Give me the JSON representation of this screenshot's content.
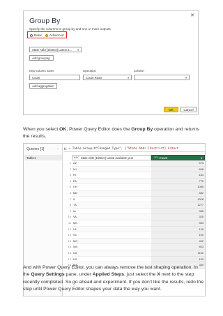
{
  "dialog": {
    "title": "Group By",
    "subtitle": "Specify the columns to group by and one or more outputs.",
    "close_glyph": "✕",
    "radio_basic": "Basic",
    "radio_advanced": "Advanced",
    "selected_mode": "Advanced",
    "group_by_value": "State Abbr [District] Latest a...",
    "add_grouping_label": "Add grouping",
    "new_column_label": "New column name",
    "new_column_value": "Count",
    "operation_label": "Operation",
    "operation_value": "Count Rows",
    "column_label": "Column",
    "add_aggregation_label": "Add aggregation",
    "ok_label": "OK",
    "cancel_label": "Cancel"
  },
  "para1": {
    "t1": "When you select ",
    "b1": "OK",
    "t2": ", Power Query Editor does the ",
    "b2": "Group By",
    "t3": " operation and returns the results."
  },
  "editor": {
    "queries_title": "Queries [1]",
    "collapse_glyph": "‹",
    "query_name": "Table1",
    "fx_label": "fx",
    "formula_prefix": "= Table.Group(#\"Changed Type\", {",
    "formula_string": "\"State Abbr [District] Latest",
    "column1_header": "State Abbr [District] Latest available year",
    "column2_header": "Count",
    "column1_type_icon": "ABC",
    "column2_type_icon": "1²3",
    "accent_color": "#217346",
    "rows": [
      {
        "n": "1",
        "state": "AZ",
        "count": "474"
      },
      {
        "n": "2",
        "state": "NJ",
        "count": "698"
      },
      {
        "n": "3",
        "state": "HI",
        "count": "164"
      },
      {
        "n": "4",
        "state": "PA",
        "count": "775"
      },
      {
        "n": "5",
        "state": "OH",
        "count": "1065"
      },
      {
        "n": "6",
        "state": "MD",
        "count": "482"
      },
      {
        "n": "7",
        "state": "IL",
        "count": "1028"
      },
      {
        "n": "8",
        "state": "TX",
        "count": "1277"
      },
      {
        "n": "9",
        "state": "IA",
        "count": "368"
      },
      {
        "n": "10",
        "state": "VA",
        "count": "325"
      },
      {
        "n": "11",
        "state": "MN",
        "count": "333"
      },
      {
        "n": "12",
        "state": "LA",
        "count": "126"
      },
      {
        "n": "13",
        "state": "SC",
        "count": "100"
      },
      {
        "n": "14",
        "state": "MO",
        "count": "402"
      },
      {
        "n": "15",
        "state": "WA",
        "count": "403"
      },
      {
        "n": "16",
        "state": "CA",
        "count": "1162"
      },
      {
        "n": "17",
        "state": "KS",
        "count": "153"
      },
      {
        "n": "18",
        "state": "MA",
        "count": "344"
      }
    ]
  },
  "para2": {
    "t1": "And with Power Query Editor, you can always remove the last shaping operation. In the ",
    "b1": "Query Settings",
    "t2": " pane, under ",
    "b2": "Applied Steps",
    "t3": ", just select the ",
    "b3": "X",
    "t4": " next to the step recently completed. So go ahead and experiment. If you don’t like the results, redo the step until Power Query Editor shapes your data the way you want."
  }
}
